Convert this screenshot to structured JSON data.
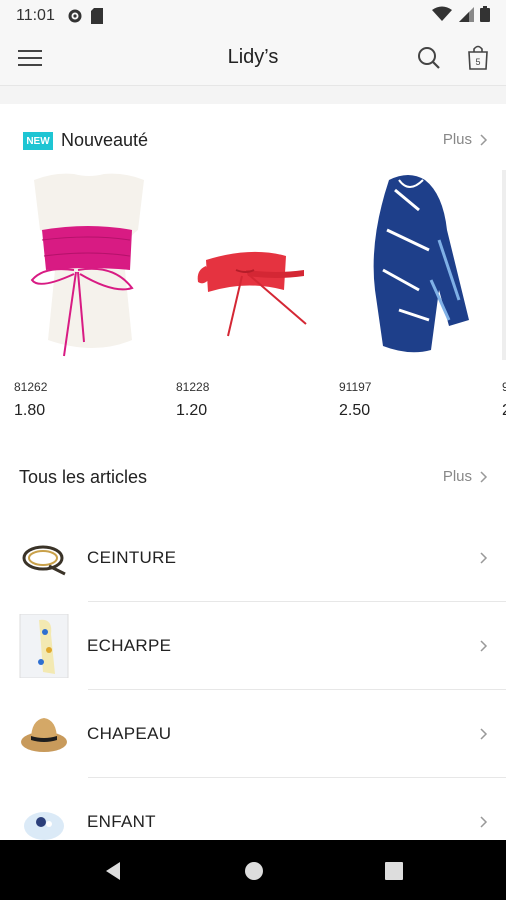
{
  "status_bar": {
    "time": "11:01"
  },
  "app_bar": {
    "title": "Lidy’s",
    "cart_count": "5"
  },
  "new_section": {
    "badge": "NEW",
    "title": "Nouveauté",
    "more_label": "Plus",
    "products": [
      {
        "code": "81262",
        "price": "1.80",
        "icon": "pink-belt"
      },
      {
        "code": "81228",
        "price": "1.20",
        "icon": "red-belt"
      },
      {
        "code": "91197",
        "price": "2.50",
        "icon": "blue-scarf"
      },
      {
        "code": "9",
        "price": "2",
        "icon": "partial-product"
      }
    ]
  },
  "all_section": {
    "title": "Tous les articles",
    "more_label": "Plus"
  },
  "categories": [
    {
      "label": "CEINTURE",
      "icon": "belt-thumbnail"
    },
    {
      "label": "ECHARPE",
      "icon": "scarf-thumbnail"
    },
    {
      "label": "CHAPEAU",
      "icon": "hat-thumbnail"
    },
    {
      "label": "ENFANT",
      "icon": "kids-thumbnail"
    }
  ],
  "colors": {
    "badge": "#1ec5d3",
    "background": "#f4f4f4",
    "card": "#ffffff",
    "navbar": "#000000"
  }
}
